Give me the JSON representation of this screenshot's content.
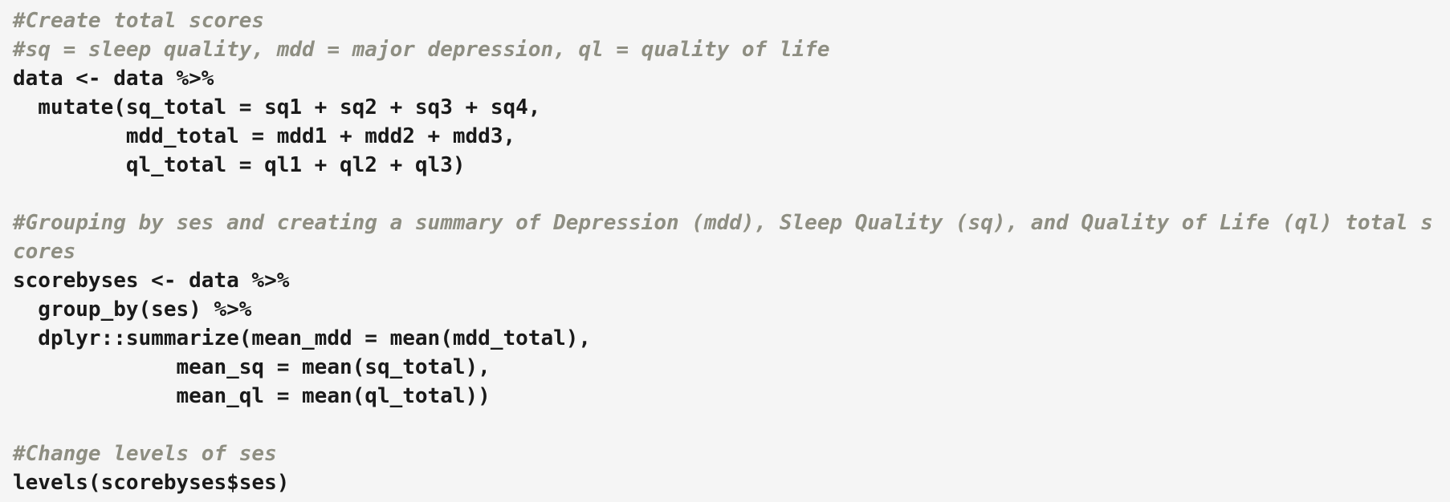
{
  "code_lines": [
    {
      "type": "comment",
      "text": "#Create total scores"
    },
    {
      "type": "comment",
      "text": "#sq = sleep quality, mdd = major depression, ql = quality of life"
    },
    {
      "type": "code",
      "text": "data <- data %>%"
    },
    {
      "type": "code",
      "text": "  mutate(sq_total = sq1 + sq2 + sq3 + sq4,"
    },
    {
      "type": "code",
      "text": "         mdd_total = mdd1 + mdd2 + mdd3,"
    },
    {
      "type": "code",
      "text": "         ql_total = ql1 + ql2 + ql3)"
    },
    {
      "type": "blank",
      "text": ""
    },
    {
      "type": "comment",
      "text": "#Grouping by ses and creating a summary of Depression (mdd), Sleep Quality (sq), and Quality of Life (ql) total s"
    },
    {
      "type": "comment",
      "text": "cores"
    },
    {
      "type": "code",
      "text": "scorebyses <- data %>%"
    },
    {
      "type": "code",
      "text": "  group_by(ses) %>%"
    },
    {
      "type": "code",
      "text": "  dplyr::summarize(mean_mdd = mean(mdd_total),"
    },
    {
      "type": "code",
      "text": "             mean_sq = mean(sq_total),"
    },
    {
      "type": "code",
      "text": "             mean_ql = mean(ql_total))"
    },
    {
      "type": "blank",
      "text": ""
    },
    {
      "type": "comment",
      "text": "#Change levels of ses"
    },
    {
      "type": "code",
      "text": "levels(scorebyses$ses)"
    }
  ]
}
